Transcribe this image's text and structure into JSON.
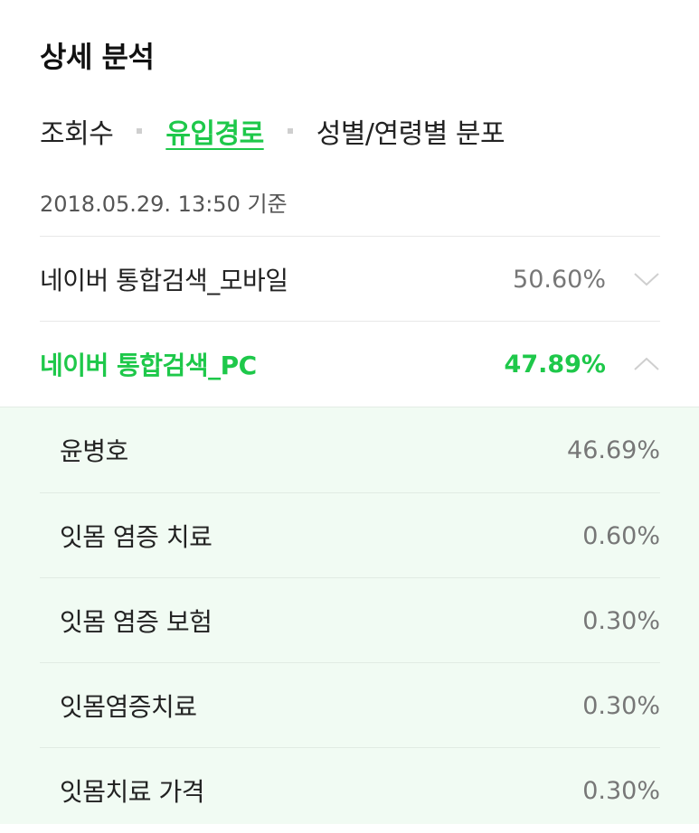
{
  "header": {
    "title": "상세 분석"
  },
  "tabs": [
    {
      "label": "조회수",
      "active": false
    },
    {
      "label": "유입경로",
      "active": true
    },
    {
      "label": "성별/연령별 분포",
      "active": false
    }
  ],
  "timestamp": "2018.05.29. 13:50 기준",
  "sources": [
    {
      "label": "네이버 통합검색_모바일",
      "percent": "50.60%",
      "expanded": false
    },
    {
      "label": "네이버 통합검색_PC",
      "percent": "47.89%",
      "expanded": true
    }
  ],
  "keywords": [
    {
      "label": "윤병호",
      "percent": "46.69%"
    },
    {
      "label": "잇몸 염증 치료",
      "percent": "0.60%"
    },
    {
      "label": "잇몸 염증 보험",
      "percent": "0.30%"
    },
    {
      "label": "잇몸염증치료",
      "percent": "0.30%"
    },
    {
      "label": "잇몸치료 가격",
      "percent": "0.30%"
    }
  ],
  "colors": {
    "accent": "#1ec84a",
    "panel_bg": "#f1fbf3",
    "muted_text": "#777777"
  },
  "icons": {
    "collapsed": "chevron-down-icon",
    "expanded": "chevron-up-icon"
  }
}
